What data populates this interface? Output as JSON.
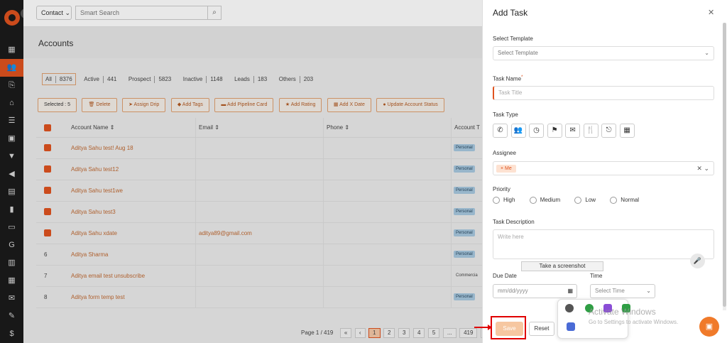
{
  "topbar": {
    "contact_select": "Contact",
    "search_placeholder": "Smart Search"
  },
  "page": {
    "title": "Accounts"
  },
  "filters": [
    {
      "label": "All",
      "count": "8376",
      "active": true
    },
    {
      "label": "Active",
      "count": "441",
      "active": false
    },
    {
      "label": "Prospect",
      "count": "5823",
      "active": false
    },
    {
      "label": "Inactive",
      "count": "1148",
      "active": false
    },
    {
      "label": "Leads",
      "count": "183",
      "active": false
    },
    {
      "label": "Others",
      "count": "203",
      "active": false
    }
  ],
  "actions": {
    "selected": "Selected : 5",
    "delete": "Delete",
    "assign_drip": "Assign Drip",
    "add_tags": "Add Tags",
    "add_pipeline_card": "Add Pipeline Card",
    "add_rating": "Add Rating",
    "add_x_date": "Add X Date",
    "update_account_status": "Update Account Status"
  },
  "grid": {
    "headers": {
      "account_name": "Account Name ⇕",
      "email": "Email ⇕",
      "phone": "Phone ⇕",
      "account_type": "Account T"
    },
    "rows": [
      {
        "name": "Aditya Sahu test! Aug 18",
        "email": "",
        "type": "Personal",
        "checked": true,
        "num": ""
      },
      {
        "name": "Aditya Sahu test12",
        "email": "",
        "type": "Personal",
        "checked": true,
        "num": ""
      },
      {
        "name": "Aditya Sahu test1we",
        "email": "",
        "type": "Personal",
        "checked": true,
        "num": ""
      },
      {
        "name": "Aditya Sahu test3",
        "email": "",
        "type": "Personal",
        "checked": true,
        "num": ""
      },
      {
        "name": "Aditya Sahu xdate",
        "email": "aditya89@gmail.com",
        "type": "Personal",
        "checked": true,
        "num": ""
      },
      {
        "name": "Aditya Sharma",
        "email": "",
        "type": "Personal",
        "checked": false,
        "num": "6"
      },
      {
        "name": "Aditya email test unsubscribe",
        "email": "",
        "type": "Commercia",
        "checked": false,
        "num": "7"
      },
      {
        "name": "Aditya form temp test",
        "email": "",
        "type": "Personal",
        "checked": false,
        "num": "8"
      }
    ]
  },
  "pager": {
    "label": "Page 1 / 419",
    "first": "«",
    "prev": "‹",
    "pages": [
      "1",
      "2",
      "3",
      "4",
      "5",
      "...",
      "419"
    ],
    "next": "›",
    "last": "»"
  },
  "panel": {
    "title": "Add Task",
    "template_label": "Select Template",
    "template_value": "Select Template",
    "task_name_label": "Task Name",
    "task_name_req": "*",
    "task_name_placeholder": "Task Title",
    "task_type_label": "Task Type",
    "task_type_icons": [
      "phone-icon",
      "meeting-icon",
      "clock-icon",
      "flag-icon",
      "email-icon",
      "food-icon",
      "logout-icon",
      "grid-icon"
    ],
    "assignee_label": "Assignee",
    "assignee_tag": "Me",
    "priority_label": "Priority",
    "priority_options": [
      "High",
      "Medium",
      "Low",
      "Normal"
    ],
    "description_label": "Task Description",
    "description_placeholder": "Write here",
    "tooltip": "Take a screenshot",
    "due_date_label": "Due Date",
    "due_date_placeholder": "mm/dd/yyyy",
    "time_label": "Time",
    "time_placeholder": "Select Time",
    "save": "Save",
    "reset": "Reset"
  },
  "windows": {
    "watermark_title": "Activate Windows",
    "watermark_sub": "Go to Settings to activate Windows."
  },
  "colors": {
    "accent": "#e0531f",
    "sidebar": "#1b1b1b"
  }
}
